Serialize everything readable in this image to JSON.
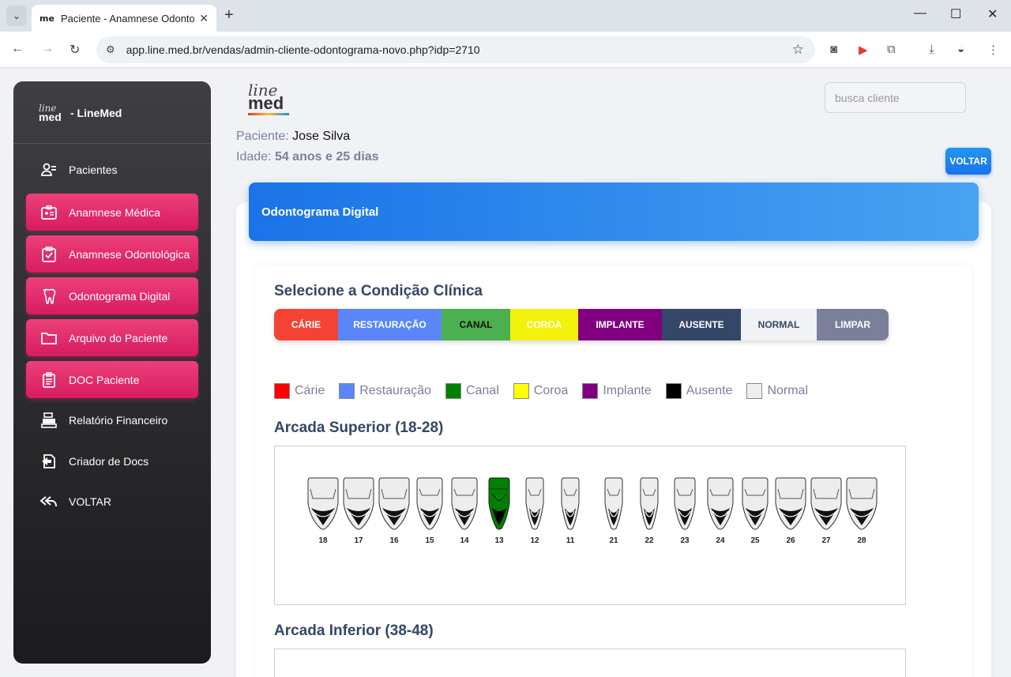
{
  "browser": {
    "tab_title": "Paciente - Anamnese Odontoló",
    "tab_favicon": "me",
    "url": "app.line.med.br/vendas/admin-cliente-odontograma-novo.php?idp=2710"
  },
  "sidebar": {
    "brand_logo_top": "line",
    "brand_logo_bottom": "med",
    "brand_name": "- LineMed",
    "items": [
      {
        "label": "Pacientes",
        "icon": "patients-icon",
        "active": false
      },
      {
        "label": "Anamnese Médica",
        "icon": "medical-id-icon",
        "active": true
      },
      {
        "label": "Anamnese Odontológica",
        "icon": "clipboard-check-icon",
        "active": true
      },
      {
        "label": "Odontograma Digital",
        "icon": "tooth-icon",
        "active": true
      },
      {
        "label": "Arquivo do Paciente",
        "icon": "folder-icon",
        "active": true
      },
      {
        "label": "DOC Paciente",
        "icon": "document-icon",
        "active": true
      },
      {
        "label": "Relatório Financeiro",
        "icon": "cash-register-icon",
        "active": false
      },
      {
        "label": "Criador de Docs",
        "icon": "doc-creator-icon",
        "active": false
      },
      {
        "label": "VOLTAR",
        "icon": "reply-all-icon",
        "active": false
      }
    ]
  },
  "header": {
    "logo_top": "line",
    "logo_bottom": "med",
    "search_placeholder": "busca cliente",
    "patient_label": "Paciente:",
    "patient_name": "Jose Silva",
    "age_label": "Idade:",
    "age_value": "54 anos e 25 dias",
    "back_button": "VOLTAR"
  },
  "card": {
    "header_title": "Odontograma Digital",
    "condition_title": "Selecione a Condição Clínica",
    "conditions": [
      {
        "label": "CÁRIE",
        "color": "#f44335",
        "text": "#ffffff",
        "width": 81
      },
      {
        "label": "RESTAURAÇÃO",
        "color": "#5b86f8",
        "text": "#ffffff",
        "width": 131
      },
      {
        "label": "CANAL",
        "color": "#4caf50",
        "text": "#111111",
        "width": 87
      },
      {
        "label": "COROA",
        "color": "#f2f20b",
        "text": "#ffffff",
        "width": 86
      },
      {
        "label": "IMPLANTE",
        "color": "#800080",
        "text": "#ffffff",
        "width": 106
      },
      {
        "label": "AUSENTE",
        "color": "#344767",
        "text": "#ffffff",
        "width": 100
      },
      {
        "label": "NORMAL",
        "color": "#f0f2f5",
        "text": "#344767",
        "width": 96
      },
      {
        "label": "LIMPAR",
        "color": "#7b809a",
        "text": "#ffffff",
        "width": 91
      }
    ],
    "legend": [
      {
        "label": "Cárie",
        "color": "#ff0000"
      },
      {
        "label": "Restauração",
        "color": "#5b86f8"
      },
      {
        "label": "Canal",
        "color": "#008000"
      },
      {
        "label": "Coroa",
        "color": "#ffff00"
      },
      {
        "label": "Implante",
        "color": "#800080"
      },
      {
        "label": "Ausente",
        "color": "#000000"
      },
      {
        "label": "Normal",
        "color": "#eeeeee"
      }
    ],
    "upper_title": "Arcada Superior (18-28)",
    "lower_title": "Arcada Inferior (38-48)",
    "upper_teeth": [
      {
        "num": "18",
        "type": "molar",
        "condition": "normal"
      },
      {
        "num": "17",
        "type": "molar",
        "condition": "normal"
      },
      {
        "num": "16",
        "type": "molar",
        "condition": "normal"
      },
      {
        "num": "15",
        "type": "premolar",
        "condition": "normal"
      },
      {
        "num": "14",
        "type": "premolar",
        "condition": "normal"
      },
      {
        "num": "13",
        "type": "canine",
        "condition": "canal"
      },
      {
        "num": "12",
        "type": "incisor",
        "condition": "normal"
      },
      {
        "num": "11",
        "type": "incisor",
        "condition": "normal"
      },
      {
        "num": "21",
        "type": "incisor",
        "condition": "normal"
      },
      {
        "num": "22",
        "type": "incisor",
        "condition": "normal"
      },
      {
        "num": "23",
        "type": "canine",
        "condition": "normal"
      },
      {
        "num": "24",
        "type": "premolar",
        "condition": "normal"
      },
      {
        "num": "25",
        "type": "premolar",
        "condition": "normal"
      },
      {
        "num": "26",
        "type": "molar",
        "condition": "normal"
      },
      {
        "num": "27",
        "type": "molar",
        "condition": "normal"
      },
      {
        "num": "28",
        "type": "molar",
        "condition": "normal"
      }
    ]
  }
}
